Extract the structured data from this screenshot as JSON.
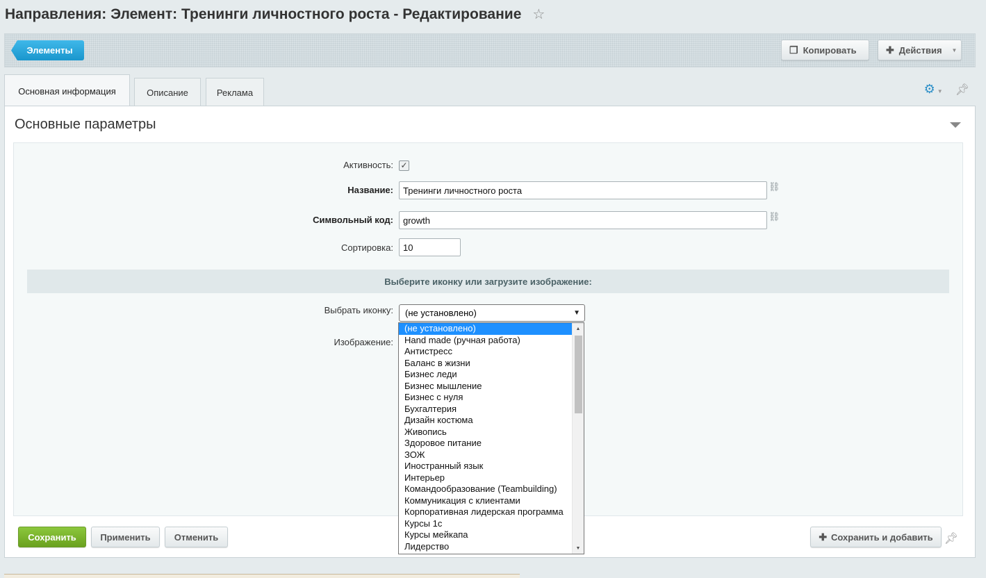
{
  "page": {
    "title": "Направления: Элемент: Тренинги личностного роста - Редактирование"
  },
  "toolbar": {
    "elements_label": "Элементы",
    "copy_label": "Копировать",
    "actions_label": "Действия"
  },
  "tabs": [
    {
      "label": "Основная информация",
      "active": true
    },
    {
      "label": "Описание",
      "active": false
    },
    {
      "label": "Реклама",
      "active": false
    }
  ],
  "section": {
    "title": "Основные параметры"
  },
  "form": {
    "active_label": "Активность:",
    "active_checked": true,
    "name_label": "Название:",
    "name_value": "Тренинги личностного роста",
    "code_label": "Символьный код:",
    "code_value": "growth",
    "sort_label": "Сортировка:",
    "sort_value": "10",
    "subheading": "Выберите иконку или загрузите изображение:",
    "icon_label": "Выбрать иконку:",
    "icon_selected": "(не установлено)",
    "image_label": "Изображение:"
  },
  "dropdown": {
    "options": [
      "(не установлено)",
      "Hand made (ручная работа)",
      "Антистресс",
      "Баланс в жизни",
      "Бизнес леди",
      "Бизнес мышление",
      "Бизнес с нуля",
      "Бухгалтерия",
      "Дизайн костюма",
      "Живопись",
      "Здоровое питание",
      "ЗОЖ",
      "Иностранный язык",
      "Интерьер",
      "Командообразование (Teambuilding)",
      "Коммуникация с клиентами",
      "Корпоративная лидерская программа",
      "Курсы 1с",
      "Курсы мейкапа",
      "Лидерство"
    ],
    "selected_index": 0
  },
  "footer": {
    "save_label": "Сохранить",
    "apply_label": "Применить",
    "cancel_label": "Отменить",
    "save_add_label": "Сохранить и добавить"
  },
  "colors": {
    "accent_blue": "#1a96cd",
    "save_green": "#6aa11e",
    "dropdown_selected": "#1e90ff"
  },
  "icons": [
    "star-icon",
    "copy-icon",
    "plus-icon",
    "gear-icon",
    "pin-icon",
    "link-icon",
    "collapse-arrow-icon"
  ]
}
